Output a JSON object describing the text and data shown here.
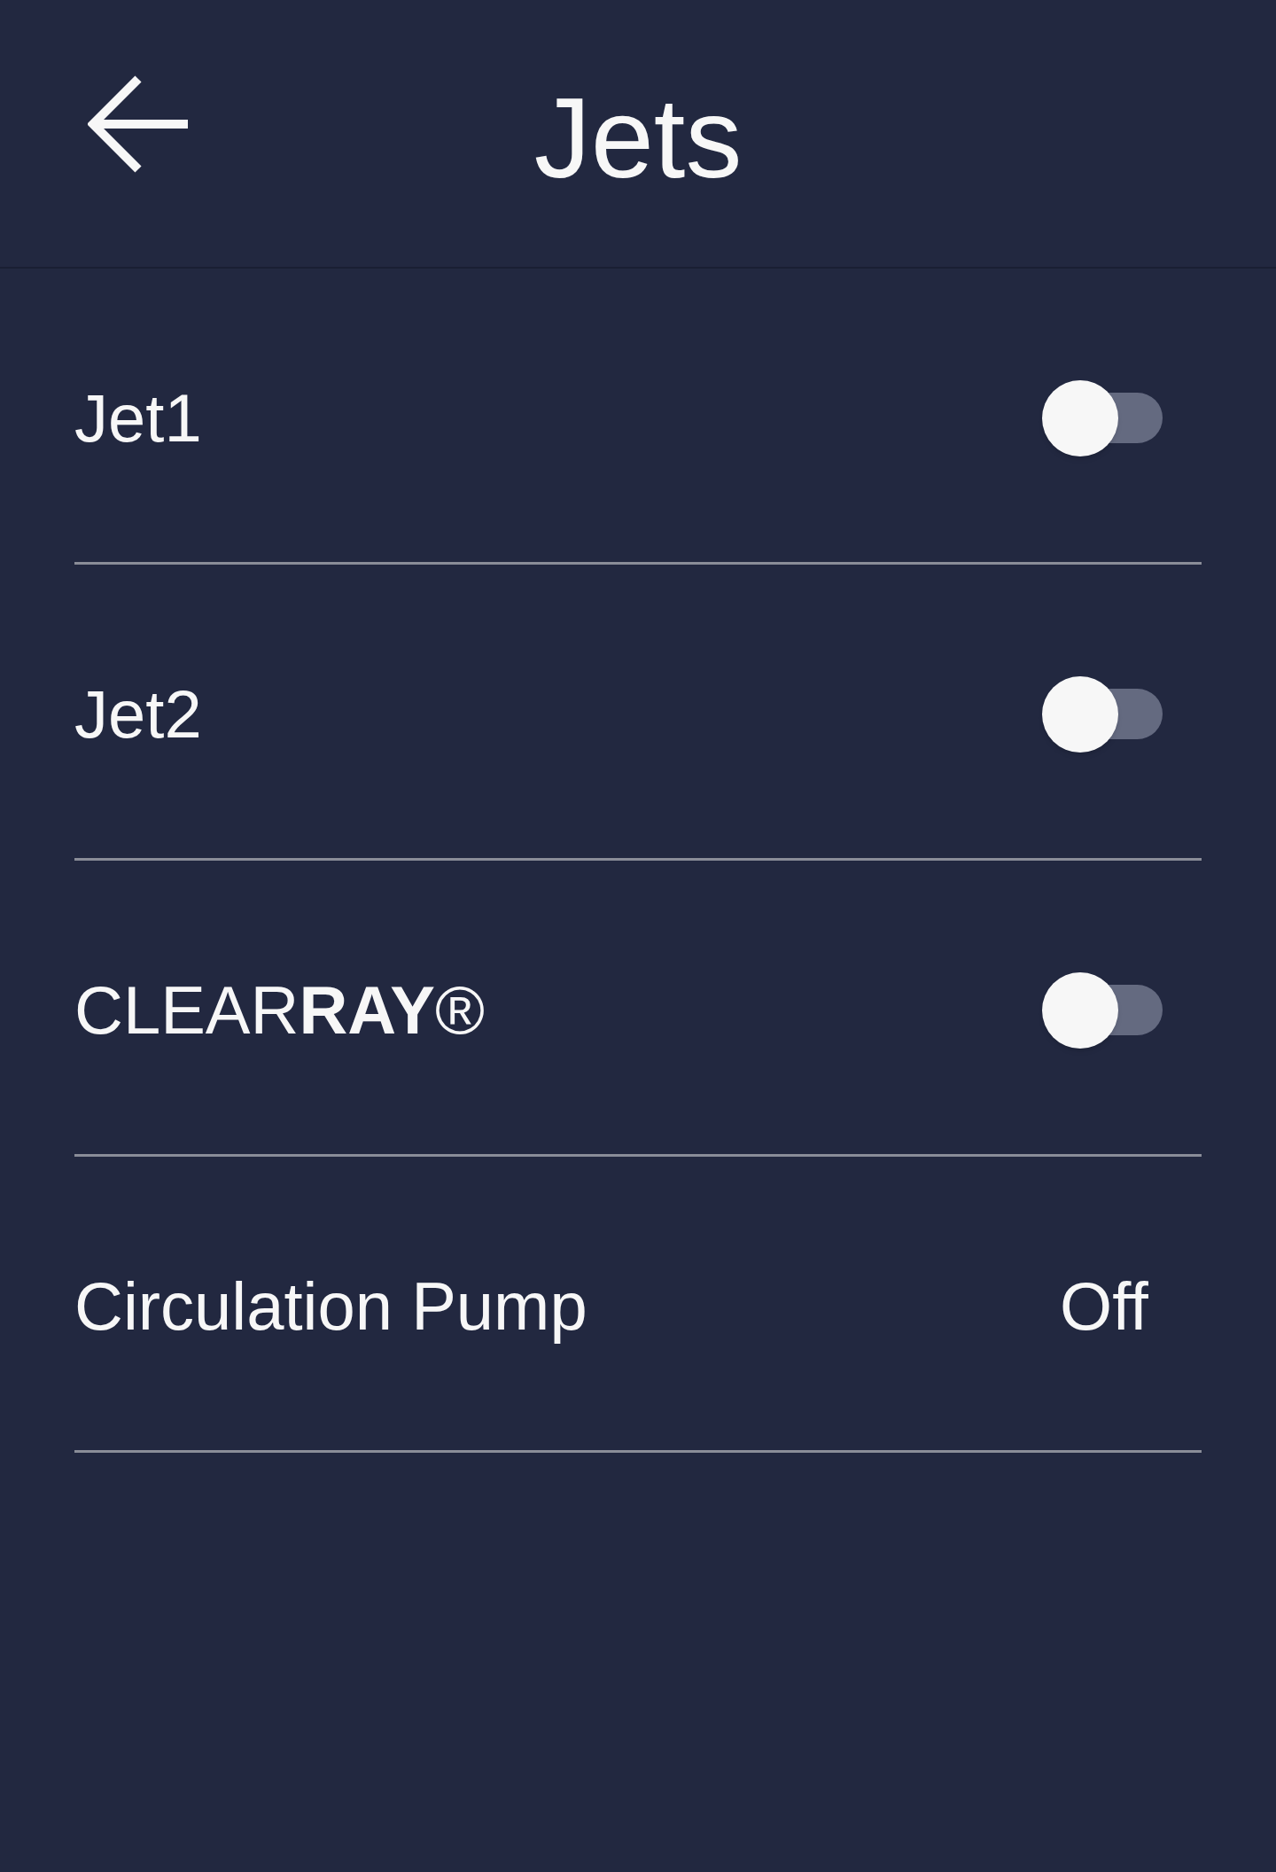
{
  "header": {
    "title": "Jets"
  },
  "rows": [
    {
      "kind": "toggle",
      "label": "Jet1",
      "on": false
    },
    {
      "kind": "toggle",
      "label": "Jet2",
      "on": false
    },
    {
      "kind": "toggle",
      "label": "CLEAR**RAY**®",
      "on": false
    },
    {
      "kind": "value",
      "label": "Circulation Pump",
      "value": "Off"
    }
  ]
}
